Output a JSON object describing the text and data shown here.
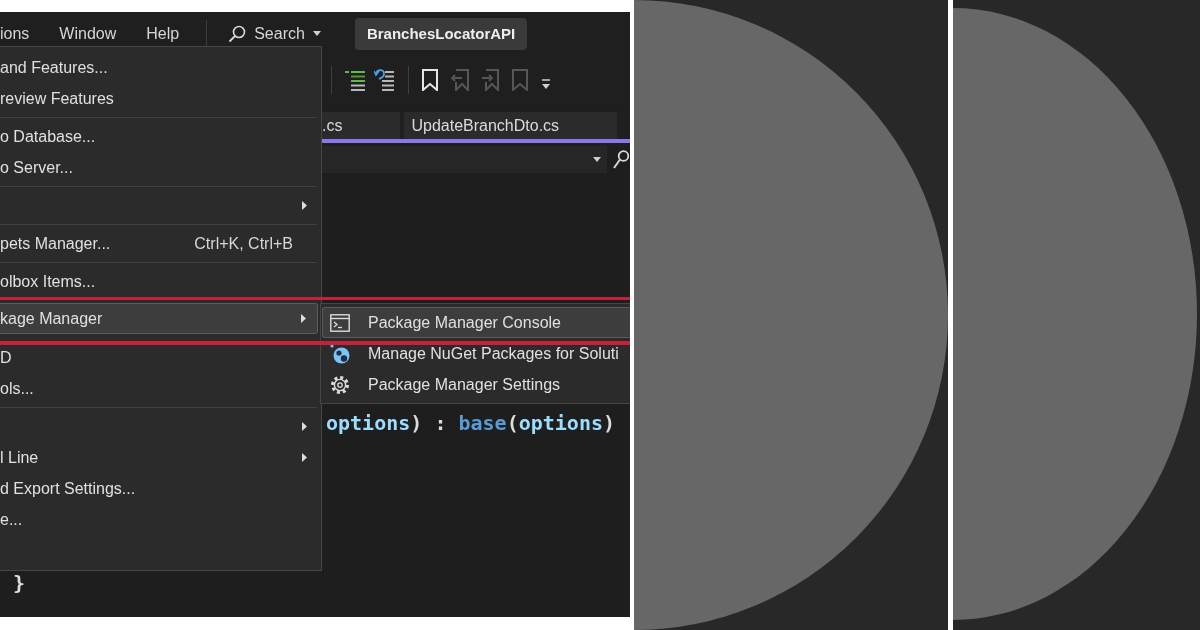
{
  "menu_bar": {
    "items": [
      "ions",
      "Window",
      "Help"
    ],
    "search": "Search",
    "solution_name": "BranchesLocatorAPI"
  },
  "toolbar": [
    {
      "kind": "comment",
      "disabled": false
    },
    {
      "kind": "uncomment",
      "disabled": false
    },
    {
      "kind": "bookmark",
      "disabled": false
    },
    {
      "kind": "bookmark-previous",
      "disabled": true
    },
    {
      "kind": "bookmark-next",
      "disabled": true
    },
    {
      "kind": "bookmark-clear",
      "disabled": true
    }
  ],
  "tabs": [
    ".cs",
    "UpdateBranchDto.cs"
  ],
  "code_lines": [
    [
      {
        "kind": "identifier",
        "text": "options"
      },
      {
        "kind": "punct",
        "text": ") : "
      },
      {
        "kind": "keyword",
        "text": "base"
      },
      {
        "kind": "punct",
        "text": "("
      },
      {
        "kind": "identifier",
        "text": "options"
      },
      {
        "kind": "punct",
        "text": ")"
      }
    ],
    [
      {
        "kind": "punct",
        "text": "}"
      }
    ]
  ],
  "menu": {
    "groups": [
      [
        {
          "label": "and Features...",
          "has_submenu": false,
          "selected": false
        },
        {
          "label": "review Features",
          "has_submenu": false,
          "selected": false
        }
      ],
      [
        {
          "label": "o Database...",
          "has_submenu": false,
          "selected": false
        },
        {
          "label": "o Server...",
          "has_submenu": false,
          "selected": false
        }
      ],
      [
        {
          "has_submenu": true,
          "selected": false
        }
      ],
      [
        {
          "label": "pets Manager...",
          "shortcut": "Ctrl+K, Ctrl+B",
          "has_submenu": false,
          "selected": false
        }
      ],
      [
        {
          "label": "olbox Items...",
          "has_submenu": false,
          "selected": false
        },
        {
          "label": "kage Manager",
          "has_submenu": true,
          "selected": true
        },
        {
          "label": "D",
          "has_submenu": false,
          "selected": false
        },
        {
          "label": "ols...",
          "has_submenu": false,
          "selected": false
        }
      ],
      [
        {
          "has_submenu": true,
          "selected": false
        },
        {
          "label": "l Line",
          "has_submenu": true,
          "selected": false
        },
        {
          "label": "d Export Settings...",
          "has_submenu": false,
          "selected": false
        },
        {
          "label": "e...",
          "has_submenu": false,
          "selected": false
        }
      ]
    ]
  },
  "submenu": [
    {
      "kind": "console",
      "label": "Package Manager Console",
      "selected": true
    },
    {
      "kind": "packages",
      "label": "Manage NuGet Packages for Soluti",
      "selected": false
    },
    {
      "kind": "settings",
      "label": "Package Manager Settings",
      "selected": false
    }
  ],
  "highlight_frame": true
}
